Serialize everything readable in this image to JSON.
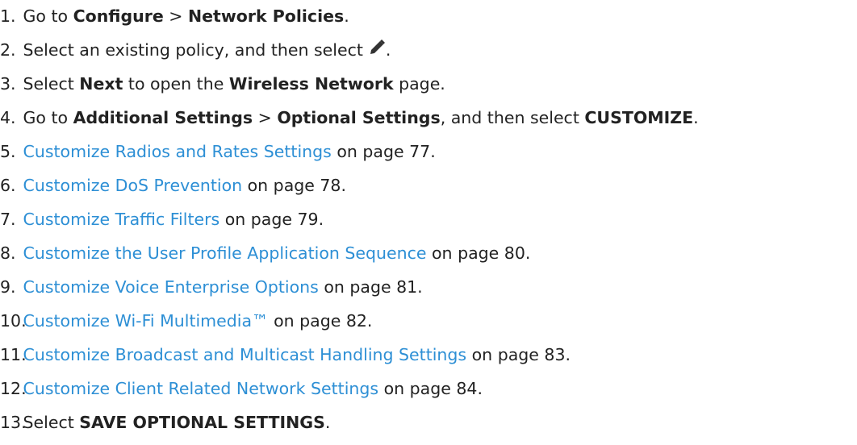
{
  "steps": [
    {
      "number": "1.",
      "parts": {
        "a": "Go to ",
        "b": "Configure",
        "c": " > ",
        "d": "Network Policies",
        "e": "."
      }
    },
    {
      "number": "2.",
      "parts": {
        "a": "Select an existing policy, and then select",
        "icon": "pencil-icon",
        "b": "."
      }
    },
    {
      "number": "3.",
      "parts": {
        "a": "Select ",
        "b": "Next",
        "c": " to open the ",
        "d": "Wireless Network",
        "e": " page."
      }
    },
    {
      "number": "4.",
      "parts": {
        "a": "Go to ",
        "b": "Additional Settings",
        "c": " > ",
        "d": "Optional Settings",
        "e": ", and then select ",
        "f": "CUSTOMIZE",
        "g": "."
      }
    },
    {
      "number": "5.",
      "link": "Customize Radios and Rates Settings",
      "suffix": " on page 77."
    },
    {
      "number": "6.",
      "link": "Customize DoS Prevention",
      "suffix": " on page 78."
    },
    {
      "number": "7.",
      "link": "Customize Traffic Filters",
      "suffix": " on page 79."
    },
    {
      "number": "8.",
      "link": "Customize the User Profile Application Sequence",
      "suffix": " on page 80."
    },
    {
      "number": "9.",
      "link": "Customize Voice Enterprise Options",
      "suffix": " on page 81."
    },
    {
      "number": "10.",
      "link": "Customize Wi-Fi Multimedia™",
      "suffix": " on page 82."
    },
    {
      "number": "11.",
      "link": "Customize Broadcast and Multicast Handling Settings",
      "suffix": " on page 83."
    },
    {
      "number": "12.",
      "link": "Customize Client Related Network Settings",
      "suffix": " on page 84."
    },
    {
      "number": "13.",
      "parts": {
        "a": "Select ",
        "b": "SAVE OPTIONAL SETTINGS",
        "c": "."
      }
    }
  ],
  "colors": {
    "text": "#222222",
    "link": "#2d8fd5"
  }
}
